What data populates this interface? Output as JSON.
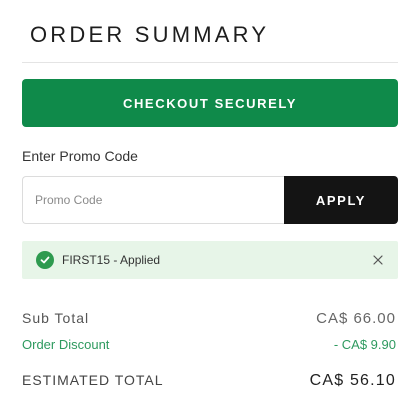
{
  "order_summary": {
    "title": "ORDER SUMMARY",
    "checkout_label": "CHECKOUT SECURELY",
    "promo": {
      "label": "Enter Promo Code",
      "placeholder": "Promo Code",
      "value": "",
      "apply_label": "APPLY"
    },
    "applied": {
      "icon": "check-circle-icon",
      "text": "FIRST15 - Applied",
      "close_icon": "close-icon"
    },
    "totals": {
      "subtotal_label": "Sub Total",
      "subtotal_value": "CA$ 66.00",
      "discount_label": "Order Discount",
      "discount_value": "- CA$ 9.90",
      "estimated_label": "ESTIMATED TOTAL",
      "estimated_value": "CA$ 56.10"
    }
  },
  "colors": {
    "checkout_green": "#0f8a4a",
    "apply_black": "#141414",
    "applied_bg": "#e7f5e8",
    "success_green": "#2e9a4f",
    "discount_green": "#2e9a5f"
  }
}
